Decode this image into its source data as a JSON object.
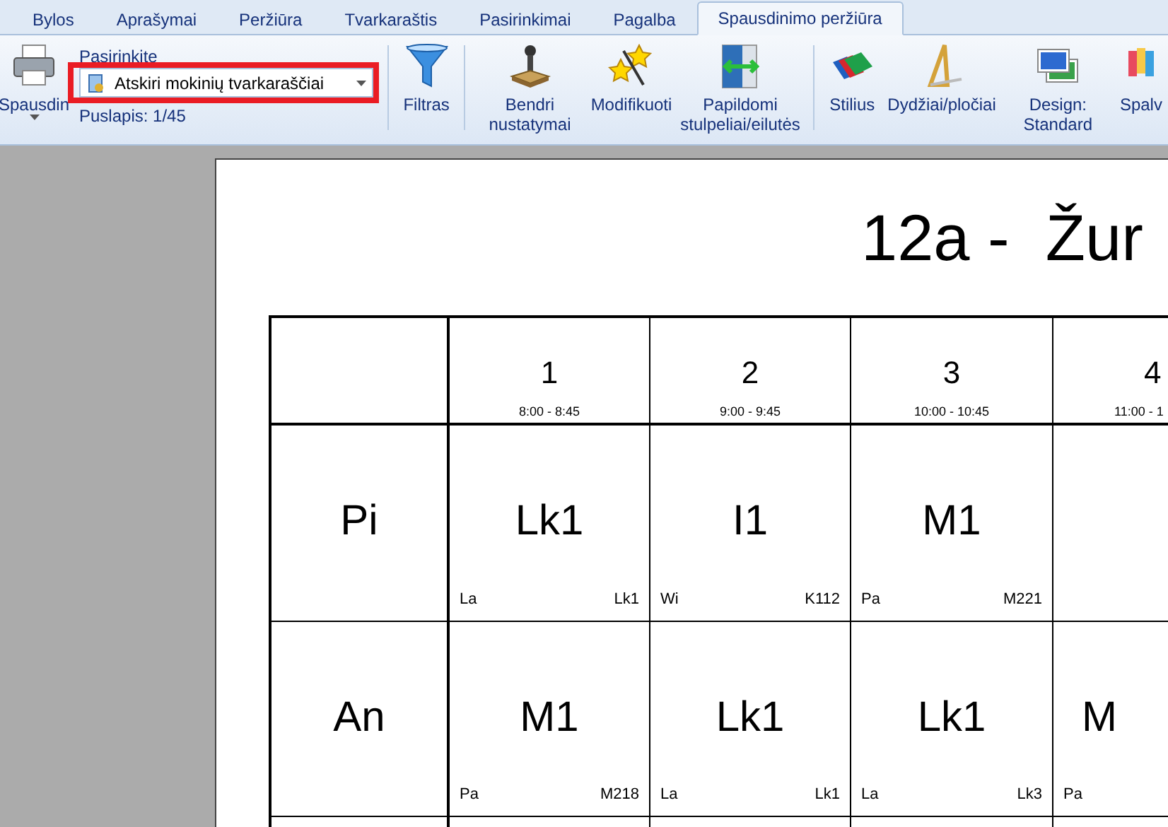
{
  "tabs": [
    {
      "label": "Bylos",
      "selected": false
    },
    {
      "label": "Aprašymai",
      "selected": false
    },
    {
      "label": "Peržiūra",
      "selected": false
    },
    {
      "label": "Tvarkaraštis",
      "selected": false
    },
    {
      "label": "Pasirinkimai",
      "selected": false
    },
    {
      "label": "Pagalba",
      "selected": false
    },
    {
      "label": "Spausdinimo peržiūra",
      "selected": true
    }
  ],
  "ribbon": {
    "print_button": {
      "label": "Spausdin"
    },
    "selector": {
      "label": "Pasirinkite",
      "value": "Atskiri mokinių tvarkaraščiai",
      "page_info": "Puslapis: 1/45",
      "highlighted": true
    },
    "groups": [
      [
        {
          "label": "Filtras",
          "kind": "filter"
        }
      ],
      [
        {
          "label": "Bendri nustatymai",
          "kind": "stamp"
        },
        {
          "label": "Modifikuoti",
          "kind": "stars"
        },
        {
          "label": "Papildomi stulpeliai/eilutės",
          "kind": "columns"
        }
      ],
      [
        {
          "label": "Stilius",
          "kind": "books"
        },
        {
          "label": "Dydžiai/pločiai",
          "kind": "ruler"
        },
        {
          "label": "Design: Standard",
          "kind": "picture"
        },
        {
          "label": "Spalv",
          "kind": "palette"
        }
      ]
    ]
  },
  "preview": {
    "title": "12a -  Žur",
    "periods": [
      {
        "number": "1",
        "time": "8:00 - 8:45"
      },
      {
        "number": "2",
        "time": "9:00 - 9:45"
      },
      {
        "number": "3",
        "time": "10:00 - 10:45"
      },
      {
        "number": "4",
        "time": "11:00 - 1"
      }
    ],
    "rows": [
      {
        "day": "Pi",
        "cells": [
          {
            "subject": "Lk1",
            "teacher": "La",
            "room": "Lk1"
          },
          {
            "subject": "I1",
            "teacher": "Wi",
            "room": "K112"
          },
          {
            "subject": "M1",
            "teacher": "Pa",
            "room": "M221"
          },
          {}
        ]
      },
      {
        "day": "An",
        "cells": [
          {
            "subject": "M1",
            "teacher": "Pa",
            "room": "M218"
          },
          {
            "subject": "Lk1",
            "teacher": "La",
            "room": "Lk1"
          },
          {
            "subject": "Lk1",
            "teacher": "La",
            "room": "Lk3"
          },
          {
            "subject": "M",
            "teacher": "Pa"
          }
        ]
      }
    ]
  }
}
